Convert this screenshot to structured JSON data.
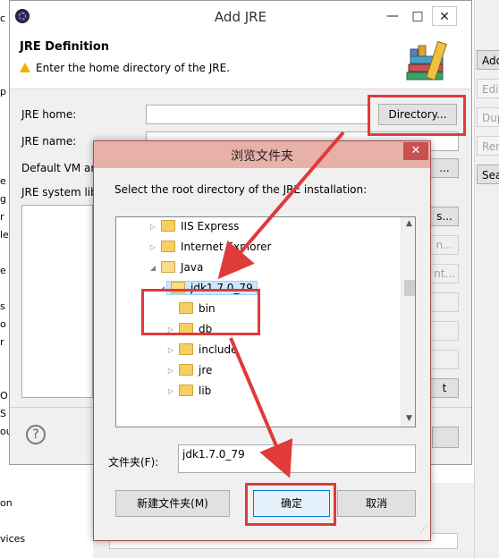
{
  "background": {
    "left_fragments": [
      "c",
      "p",
      "e",
      "g",
      "r",
      "le",
      "e",
      "s",
      "o",
      "r",
      "O",
      "S",
      "ou",
      "on",
      "vices"
    ],
    "right_buttons": [
      {
        "label": "Add...",
        "enabled": true
      },
      {
        "label": "Edit...",
        "enabled": false
      },
      {
        "label": "Duplicate...",
        "enabled": false
      },
      {
        "label": "Remove",
        "enabled": false
      },
      {
        "label": "Search...",
        "enabled": true
      }
    ]
  },
  "add_jre": {
    "title": "Add JRE",
    "title_buttons": {
      "minimize": "—",
      "maximize": "□",
      "close": "✕"
    },
    "heading": "JRE Definition",
    "warning": "Enter the home directory of the JRE.",
    "jre_home_label": "JRE home:",
    "jre_name_label": "JRE name:",
    "default_vm_label": "Default VM ar",
    "system_libs_label": "JRE system lib",
    "directory_button": "Directory...",
    "right_buttons": [
      "...",
      "s...",
      "n...",
      "nt...",
      "",
      "",
      "",
      "t"
    ],
    "help_icon_glyph": "?"
  },
  "browse": {
    "title": "浏览文件夹",
    "close_glyph": "✕",
    "prompt": "Select the root directory of the JRE installation:",
    "tree": [
      {
        "label": "IIS Express",
        "level": 1,
        "expander": "collapsed"
      },
      {
        "label": "Internet Explorer",
        "level": 1,
        "expander": "collapsed"
      },
      {
        "label": "Java",
        "level": 1,
        "expander": "expanded"
      },
      {
        "label": "jdk1.7.0_79",
        "level": 2,
        "expander": "expanded",
        "selected": true
      },
      {
        "label": "bin",
        "level": 3,
        "expander": "none"
      },
      {
        "label": "db",
        "level": 3,
        "expander": "collapsed"
      },
      {
        "label": "include",
        "level": 3,
        "expander": "collapsed"
      },
      {
        "label": "jre",
        "level": 3,
        "expander": "collapsed"
      },
      {
        "label": "lib",
        "level": 3,
        "expander": "collapsed"
      }
    ],
    "folder_label": "文件夹(F):",
    "folder_value": "jdk1.7.0_79",
    "new_folder_button": "新建文件夹(M)",
    "ok_button": "确定",
    "cancel_button": "取消"
  },
  "colors": {
    "annotation_red": "#e03a3a",
    "selection_bg": "#cce8ff",
    "browse_title_bg": "#e8b1a7"
  }
}
